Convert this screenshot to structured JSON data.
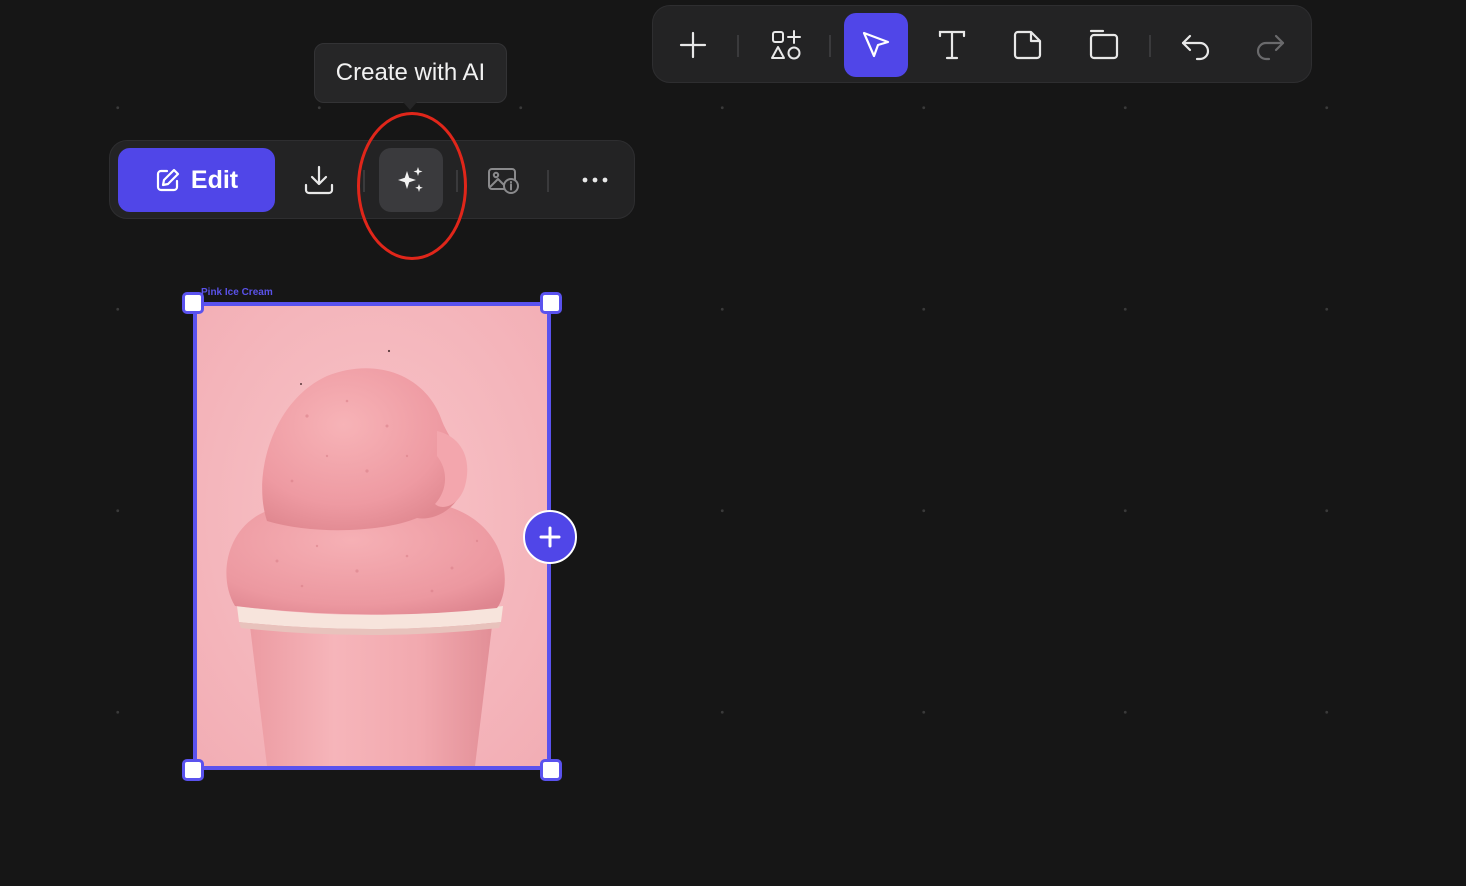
{
  "tooltip": {
    "text": "Create with AI"
  },
  "context_toolbar": {
    "edit_label": "Edit",
    "icons": [
      "edit-icon",
      "download-icon",
      "sparkles-icon",
      "image-info-icon",
      "more-icon"
    ]
  },
  "main_toolbar": {
    "tools": [
      "plus-icon",
      "shapes-icon",
      "cursor-icon",
      "text-icon",
      "sticky-note-icon",
      "frame-icon",
      "undo-icon",
      "redo-icon"
    ],
    "active_tool": "cursor-icon"
  },
  "frame": {
    "label": "Pink Ice Cream"
  },
  "colors": {
    "accent": "#5046e8",
    "annotation": "#e0261a",
    "background": "#161616"
  }
}
